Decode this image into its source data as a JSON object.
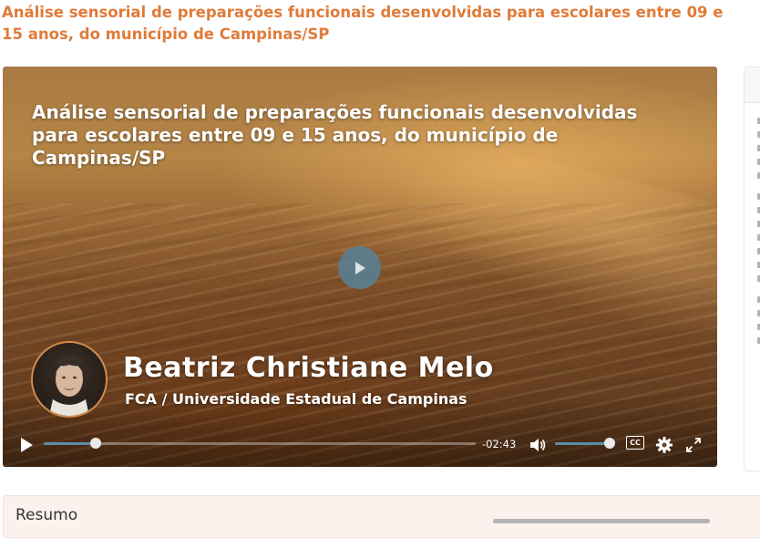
{
  "page": {
    "title": "Análise sensorial de preparações funcionais desenvolvidas para escolares entre 09 e 15 anos, do município de Campinas/SP"
  },
  "player": {
    "title_lines": [
      "Análise sensorial de preparações funcionais desenvolvidas",
      "para escolares entre 09 e 15 anos, do município de",
      "Campinas/SP"
    ],
    "presenter_name": "Beatriz Christiane Melo",
    "presenter_affiliation": "FCA / Universidade Estadual de Campinas",
    "remaining_time": "-02:43",
    "progress_fraction": 0.12,
    "volume_fraction": 1.0,
    "cc_label": "CC",
    "accent_color": "#5b8ea8",
    "icons": [
      "play-icon",
      "volume-icon",
      "captions-icon",
      "gear-icon",
      "fullscreen-icon"
    ]
  },
  "summary": {
    "label": "Resumo"
  },
  "colors": {
    "title_orange": "#e07b39",
    "summary_bg": "#fbf2ed"
  }
}
